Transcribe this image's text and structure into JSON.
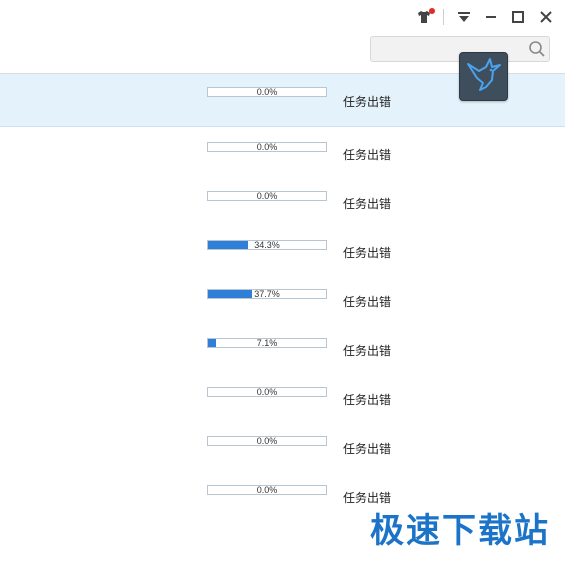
{
  "search": {
    "placeholder": "",
    "value": ""
  },
  "tasks": [
    {
      "progress": "0.0%",
      "fraction": 0.0,
      "status": "任务出错"
    },
    {
      "progress": "0.0%",
      "fraction": 0.0,
      "status": "任务出错"
    },
    {
      "progress": "0.0%",
      "fraction": 0.0,
      "status": "任务出错"
    },
    {
      "progress": "34.3%",
      "fraction": 0.343,
      "status": "任务出错"
    },
    {
      "progress": "37.7%",
      "fraction": 0.377,
      "status": "任务出错"
    },
    {
      "progress": "7.1%",
      "fraction": 0.071,
      "status": "任务出错"
    },
    {
      "progress": "0.0%",
      "fraction": 0.0,
      "status": "任务出错"
    },
    {
      "progress": "0.0%",
      "fraction": 0.0,
      "status": "任务出错"
    },
    {
      "progress": "0.0%",
      "fraction": 0.0,
      "status": "任务出错"
    }
  ],
  "watermark": "极速下载站",
  "colors": {
    "accent": "#2f7fd8",
    "selected_row": "#e4f2fc",
    "float_button": "#3f4e5d"
  },
  "icons": [
    "skin-icon",
    "menu-icon",
    "minimize-icon",
    "maximize-icon",
    "close-icon",
    "search-icon",
    "bird-icon"
  ]
}
